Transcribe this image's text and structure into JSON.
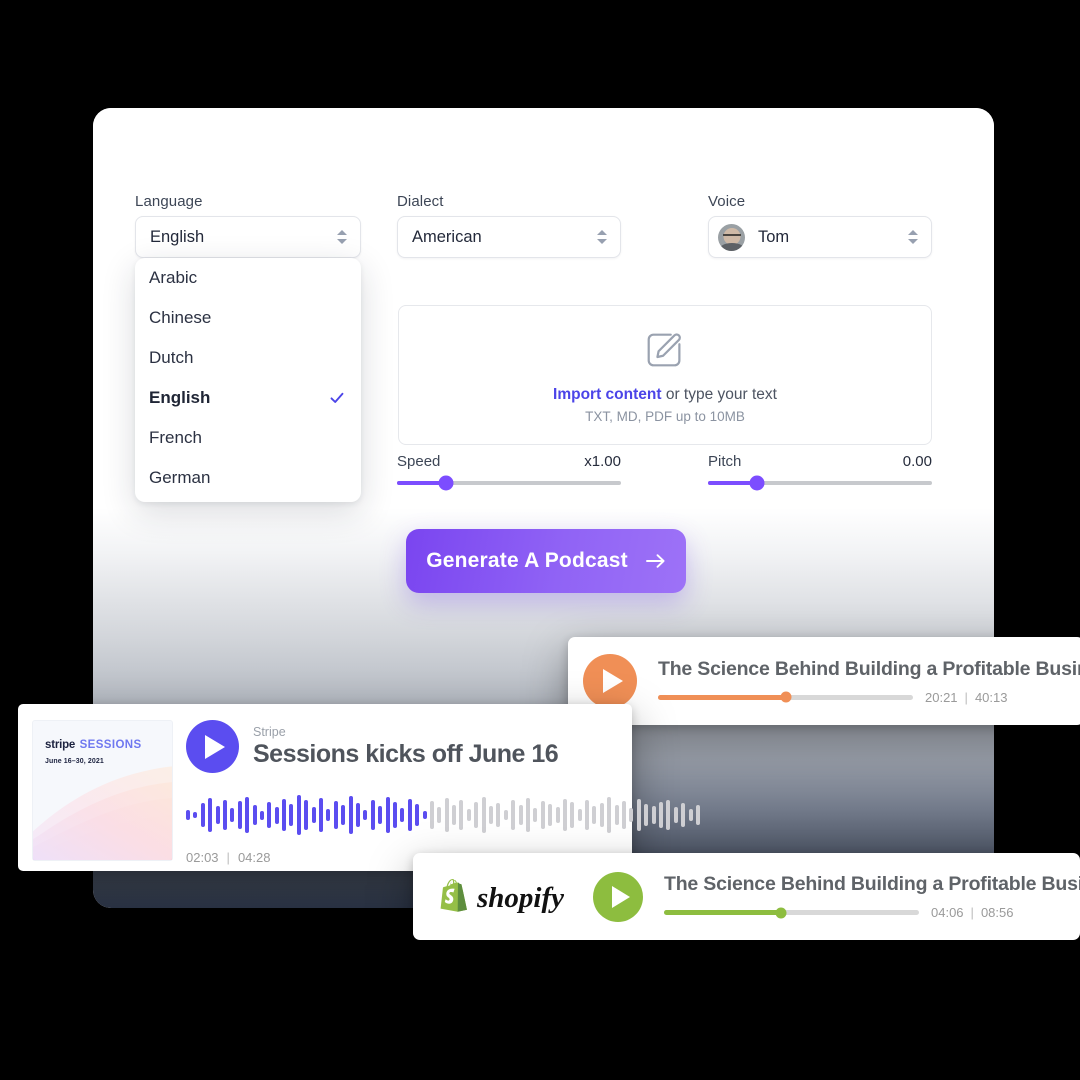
{
  "theme": {
    "accent_purple": "#7c4dff",
    "link_purple": "#4b44e8",
    "orange": "#f08f56",
    "green": "#8dbd3f",
    "stripe_purple": "#5b4df0",
    "card_dark": "#2b3446"
  },
  "form": {
    "language": {
      "label": "Language",
      "value": "English",
      "icon": "chevron-updown-icon",
      "options": [
        "Arabic",
        "Chinese",
        "Dutch",
        "English",
        "French",
        "German"
      ],
      "selected": "English",
      "check_icon": "check-icon"
    },
    "dialect": {
      "label": "Dialect",
      "value": "American",
      "icon": "chevron-updown-icon"
    },
    "voice": {
      "label": "Voice",
      "value": "Tom",
      "avatar": "voice-avatar-tom",
      "icon": "chevron-updown-icon"
    }
  },
  "import": {
    "icon": "compose-document-icon",
    "link_text": "Import content",
    "rest_text": " or type your text",
    "hint": "TXT, MD, PDF up to 10MB"
  },
  "sliders": [
    {
      "name": "Speed",
      "value": "x1.00",
      "percent": 22
    },
    {
      "name": "Pitch",
      "value": "0.00",
      "percent": 22
    }
  ],
  "cta": {
    "label": "Generate A Podcast",
    "icon": "arrow-right-icon"
  },
  "players": {
    "orange": {
      "title": "The Science Behind Building a Profitable Business",
      "play_icon": "play-icon",
      "current_time": "20:21",
      "separator": "|",
      "total_time": "40:13",
      "percent": 50,
      "color": "#f08f56"
    },
    "stripe": {
      "brand": "Stripe",
      "title": "Sessions kicks off June 16",
      "play_icon": "play-icon",
      "current_time": "02:03",
      "separator": "|",
      "total_time": "04:28",
      "percent": 46,
      "color": "#5b4df0",
      "artwork": {
        "logo_stripe": "stripe",
        "logo_sessions": "SESSIONS",
        "date": "June 16–30, 2021"
      }
    },
    "shopify": {
      "brand_logo": "shopify-logo",
      "brand_name": "shopify",
      "title": "The Science Behind Building a Profitable Business",
      "play_icon": "play-icon",
      "current_time": "04:06",
      "separator": "|",
      "total_time": "08:56",
      "percent": 46,
      "color": "#8dbd3f"
    }
  }
}
